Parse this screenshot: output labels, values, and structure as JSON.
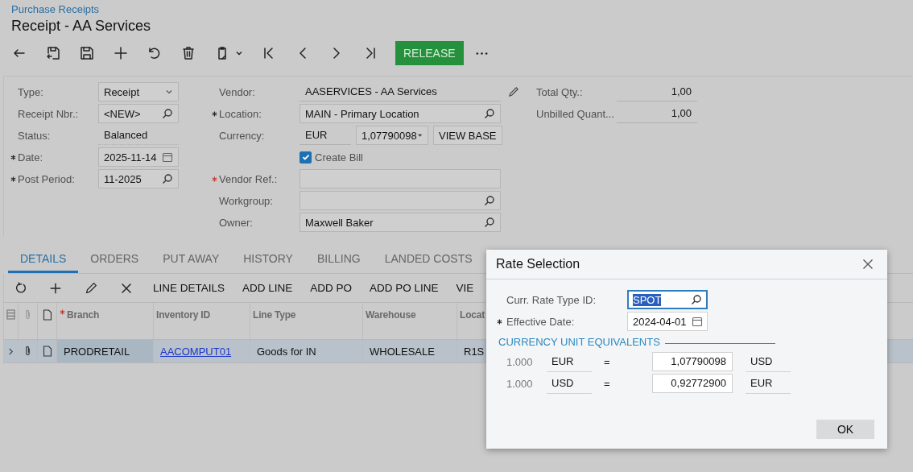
{
  "breadcrumb": "Purchase Receipts",
  "title": "Receipt - AA Services",
  "toolbar": {
    "primary_action": "RELEASE"
  },
  "form": {
    "left": [
      {
        "label": "Type:",
        "kind": "select",
        "value": "Receipt",
        "required": false
      },
      {
        "label": "Receipt Nbr.:",
        "kind": "lookup",
        "value": "<NEW>",
        "required": false
      },
      {
        "label": "Status:",
        "kind": "static",
        "value": "Balanced",
        "required": false
      },
      {
        "label": "Date:",
        "kind": "date",
        "value": "2025-11-14",
        "required": true
      },
      {
        "label": "Post Period:",
        "kind": "lookup",
        "value": "11-2025",
        "required": true
      }
    ],
    "middle": [
      {
        "label": "Vendor:",
        "kind": "display",
        "value": "AASERVICES - AA Services",
        "required": false
      },
      {
        "label": "Location:",
        "kind": "lookup",
        "value": "MAIN - Primary Location",
        "required": true
      },
      {
        "label": "Currency:",
        "kind": "currency",
        "value": "EUR",
        "rate": "1,07790098",
        "button": "VIEW BASE",
        "required": false
      },
      {
        "label": "Create Bill",
        "kind": "checkbox",
        "checked": true
      },
      {
        "label": "Vendor Ref.:",
        "kind": "text",
        "required": true,
        "error": true
      },
      {
        "label": "Workgroup:",
        "kind": "lookup",
        "required": false
      },
      {
        "label": "Owner:",
        "kind": "lookup",
        "value": "Maxwell Baker",
        "required": false
      }
    ],
    "right": [
      {
        "label": "Total Qty.:",
        "value": "1,00"
      },
      {
        "label": "Unbilled Quant...",
        "value": "1,00"
      }
    ]
  },
  "tabs": [
    {
      "label": "DETAILS",
      "selected": true
    },
    {
      "label": "ORDERS",
      "selected": false
    },
    {
      "label": "PUT AWAY",
      "selected": false
    },
    {
      "label": "HISTORY",
      "selected": false
    },
    {
      "label": "BILLING",
      "selected": false
    },
    {
      "label": "LANDED COSTS",
      "selected": false
    }
  ],
  "grid_actions": [
    "LINE DETAILS",
    "ADD LINE",
    "ADD PO",
    "ADD PO LINE",
    "VIE"
  ],
  "table": {
    "columns": [
      {
        "label": "Branch",
        "required": true
      },
      {
        "label": "Inventory ID",
        "required": false
      },
      {
        "label": "Line Type",
        "required": false
      },
      {
        "label": "Warehouse",
        "required": false
      },
      {
        "label": "Locat",
        "required": false
      }
    ],
    "rows": [
      {
        "selected": true,
        "cells": [
          {
            "text": "PRODRETAIL",
            "kind": "text"
          },
          {
            "text": "AACOMPUT01",
            "kind": "link"
          },
          {
            "text": "Goods for IN",
            "kind": "text"
          },
          {
            "text": "WHOLESALE",
            "kind": "text"
          },
          {
            "text": "R1S",
            "kind": "text"
          }
        ]
      }
    ]
  },
  "dialog": {
    "title": "Rate Selection",
    "fields": [
      {
        "label": "Curr. Rate Type ID:",
        "kind": "lookup",
        "value": "SPOT",
        "required": false,
        "focused": true
      },
      {
        "label": "Effective Date:",
        "kind": "date",
        "value": "2024-04-01",
        "required": true,
        "focused": false
      }
    ],
    "section": "CURRENCY UNIT EQUIVALENTS",
    "rates": [
      {
        "qty": "1.000",
        "from": "EUR",
        "sign": "=",
        "value": "1,07790098",
        "to": "USD"
      },
      {
        "qty": "1.000",
        "from": "USD",
        "sign": "=",
        "value": "0,92772900",
        "to": "EUR"
      }
    ],
    "ok": "OK"
  }
}
